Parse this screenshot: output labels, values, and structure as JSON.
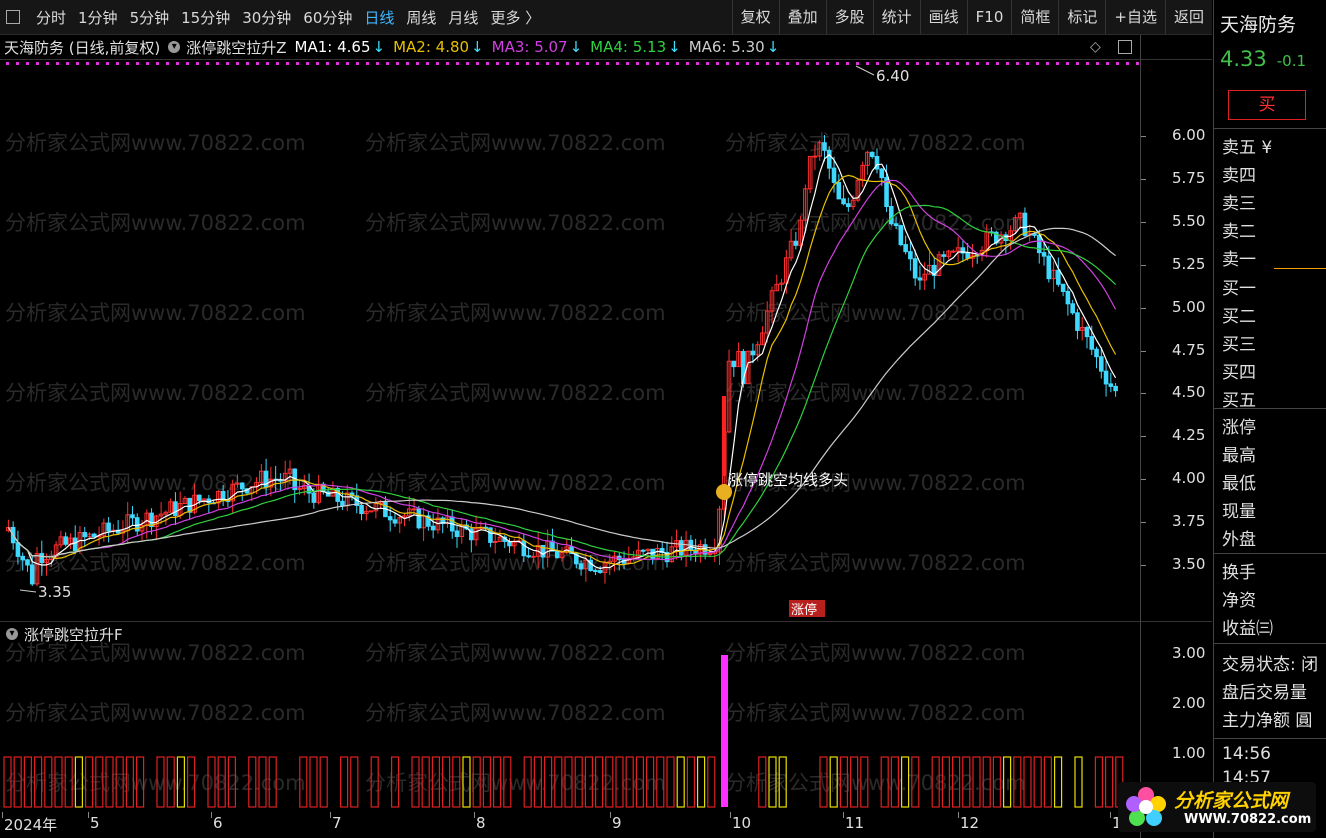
{
  "toolbar": {
    "periods": [
      "分时",
      "1分钟",
      "5分钟",
      "15分钟",
      "30分钟",
      "60分钟",
      "日线",
      "周线",
      "月线",
      "更多 〉"
    ],
    "active_period": "日线",
    "tools": [
      "复权",
      "叠加",
      "多股",
      "统计",
      "画线",
      "F10",
      "简框",
      "标记",
      "+自选",
      "返回"
    ]
  },
  "info": {
    "title": "天海防务 (日线,前复权)",
    "indicator": "涨停跳空拉升Z",
    "ma": [
      {
        "label": "MA1: 4.65",
        "color": "#ffffff"
      },
      {
        "label": "MA2: 4.80",
        "color": "#e8c000"
      },
      {
        "label": "MA3: 5.07",
        "color": "#d040e0"
      },
      {
        "label": "MA4: 5.13",
        "color": "#30d040"
      },
      {
        "label": "MA6: 5.30",
        "color": "#cccccc"
      }
    ]
  },
  "watermark": "分析家公式网www.70822.com",
  "chart_labels": {
    "high": "6.40",
    "low": "3.35",
    "signal": "涨停跳空均线多头",
    "badge": "涨停"
  },
  "sub_title": "涨停跳空拉升F",
  "chart_data": [
    {
      "type": "candlestick",
      "ylim": [
        3.3,
        6.4
      ],
      "yticks": [
        "6.00",
        "5.75",
        "5.50",
        "5.25",
        "5.00",
        "4.75",
        "4.50",
        "4.25",
        "4.00",
        "3.75",
        "3.50"
      ],
      "x_ticks": [
        "2024年",
        "5",
        "6",
        "7",
        "8",
        "9",
        "10",
        "11",
        "12",
        "1"
      ],
      "series": [
        {
          "name": "MA1",
          "value": 4.65
        },
        {
          "name": "MA2",
          "value": 4.8
        },
        {
          "name": "MA3",
          "value": 5.07
        },
        {
          "name": "MA4",
          "value": 5.13
        },
        {
          "name": "MA6",
          "value": 5.3
        }
      ],
      "annotations": [
        {
          "text": "6.40",
          "value": 6.4
        },
        {
          "text": "3.35",
          "value": 3.35
        },
        {
          "text": "涨停跳空均线多头"
        }
      ]
    },
    {
      "type": "bar",
      "ylim": [
        0,
        3.2
      ],
      "yticks": [
        "3.00",
        "2.00",
        "1.00"
      ],
      "values_note_peak": 3.0
    }
  ],
  "right_panel": {
    "name": "天海防务",
    "price": "4.33",
    "change": "-0.1",
    "buy_label": "买",
    "sell_rows": [
      "卖五 ¥",
      "卖四",
      "卖三",
      "卖二",
      "卖一"
    ],
    "buy_rows": [
      "买一",
      "买二",
      "买三",
      "买四",
      "买五"
    ],
    "stats_rows": [
      "涨停",
      "最高",
      "最低",
      "现量",
      "外盘"
    ],
    "more_rows": [
      "换手",
      "净资",
      "收益㈢"
    ],
    "bottom_rows": [
      "交易状态: 闭",
      "盘后交易量",
      "主力净额 圓"
    ],
    "times": [
      "14:56",
      "14:57"
    ]
  },
  "logo": {
    "line1": "分析家公式网",
    "line2": "WWW.70822.com"
  },
  "colors": {
    "up": "#ff3030",
    "down": "#3fd8ff",
    "accent": "#3fb7ff",
    "signal": "#ff30ff"
  }
}
